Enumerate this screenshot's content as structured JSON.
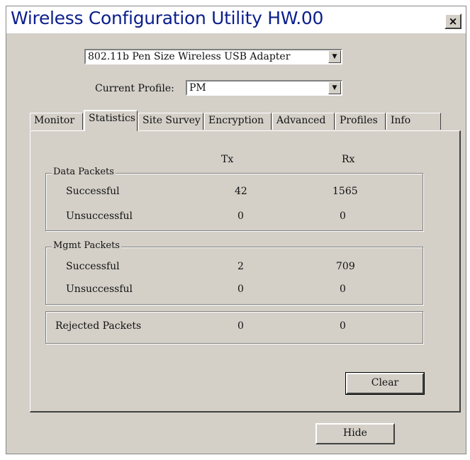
{
  "window": {
    "title": "Wireless Configuration Utility HW.00",
    "close_label": "×"
  },
  "adapter": {
    "selected": "802.11b Pen Size Wireless USB Adapter"
  },
  "profile": {
    "label": "Current Profile:",
    "selected": "PM"
  },
  "tabs": [
    {
      "label": "Monitor"
    },
    {
      "label": "Statistics",
      "active": true
    },
    {
      "label": "Site Survey"
    },
    {
      "label": "Encryption"
    },
    {
      "label": "Advanced"
    },
    {
      "label": "Profiles"
    },
    {
      "label": "Info"
    }
  ],
  "stats": {
    "columns": {
      "tx": "Tx",
      "rx": "Rx"
    },
    "data_packets": {
      "title": "Data Packets",
      "successful": {
        "label": "Successful",
        "tx": "42",
        "rx": "1565"
      },
      "unsuccessful": {
        "label": "Unsuccessful",
        "tx": "0",
        "rx": "0"
      }
    },
    "mgmt_packets": {
      "title": "Mgmt Packets",
      "successful": {
        "label": "Successful",
        "tx": "2",
        "rx": "709"
      },
      "unsuccessful": {
        "label": "Unsuccessful",
        "tx": "0",
        "rx": "0"
      }
    },
    "rejected": {
      "label": "Rejected Packets",
      "tx": "0",
      "rx": "0"
    }
  },
  "buttons": {
    "clear": "Clear",
    "hide": "Hide"
  }
}
